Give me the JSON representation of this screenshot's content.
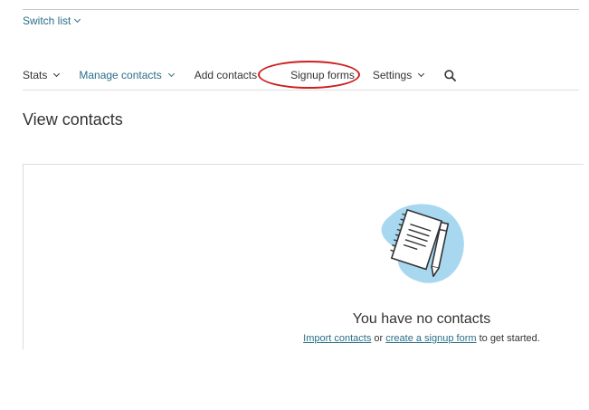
{
  "header": {
    "switch_list_label": "Switch list"
  },
  "nav": {
    "stats": "Stats",
    "manage_contacts": "Manage contacts",
    "add_contacts": "Add contacts",
    "signup_forms": "Signup forms",
    "settings": "Settings",
    "search_icon": "search-icon"
  },
  "annotation": {
    "highlighted_item": "Signup forms",
    "color": "#cc1f1f"
  },
  "page": {
    "title": "View contacts"
  },
  "empty_state": {
    "title": "You have no contacts",
    "import_link": "Import contacts",
    "or_text": " or ",
    "signup_link": "create a signup form",
    "suffix_text": " to get started.",
    "illustration_icon": "notepad-pencil-icon"
  },
  "colors": {
    "link": "#2a6f87",
    "text": "#333333",
    "divider": "#dddddd",
    "illustration_blob": "#a8d8f0"
  }
}
